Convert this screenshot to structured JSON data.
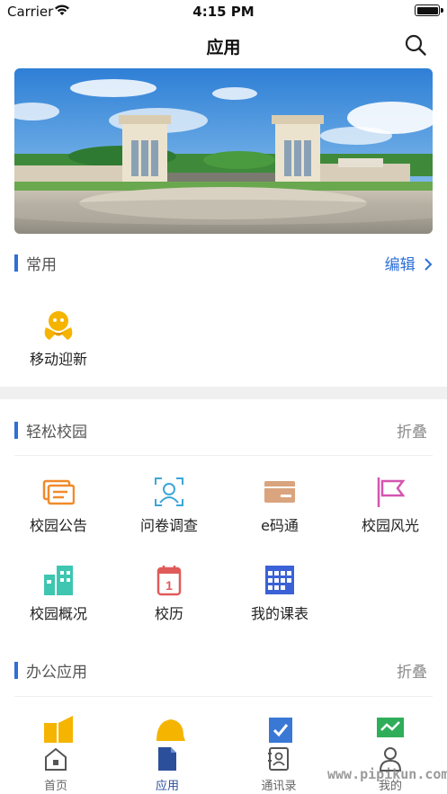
{
  "status_bar": {
    "carrier": "Carrier",
    "time": "4:15 PM",
    "battery_level": 1.0
  },
  "nav": {
    "title": "应用"
  },
  "banner": {
    "alt": "campus-gate-photo"
  },
  "sections": {
    "common": {
      "title": "常用",
      "action": "编辑",
      "apps": [
        {
          "label": "移动迎新",
          "icon": "mascot-icon",
          "color": "#f5b400"
        }
      ]
    },
    "campus": {
      "title": "轻松校园",
      "action": "折叠",
      "apps": [
        {
          "label": "校园公告",
          "icon": "announcement-icon",
          "color": "#f08a2c"
        },
        {
          "label": "问卷调查",
          "icon": "questionnaire-icon",
          "color": "#3da6d8"
        },
        {
          "label": "e码通",
          "icon": "ecode-card-icon",
          "color": "#d9a47e"
        },
        {
          "label": "校园风光",
          "icon": "flag-icon",
          "color": "#d455b0"
        },
        {
          "label": "校园概况",
          "icon": "building-icon",
          "color": "#3ec6b0"
        },
        {
          "label": "校历",
          "icon": "calendar-icon",
          "color": "#e05a5a"
        },
        {
          "label": "我的课表",
          "icon": "timetable-icon",
          "color": "#3a62d6"
        }
      ]
    },
    "office": {
      "title": "办公应用",
      "action": "折叠",
      "apps": [
        {
          "icon": "speaker-icon",
          "color": "#f5b400"
        },
        {
          "icon": "bell-icon",
          "color": "#f5b400"
        },
        {
          "icon": "task-check-icon",
          "color": "#3a78d6"
        },
        {
          "icon": "monitor-chart-icon",
          "color": "#2fae5a"
        }
      ]
    }
  },
  "tabs": [
    {
      "label": "首页",
      "icon": "home-icon",
      "active": false
    },
    {
      "label": "应用",
      "icon": "document-icon",
      "active": true
    },
    {
      "label": "通讯录",
      "icon": "contacts-icon",
      "active": false
    },
    {
      "label": "我的",
      "icon": "profile-icon",
      "active": false
    }
  ],
  "watermark": "www.pipikun.com"
}
